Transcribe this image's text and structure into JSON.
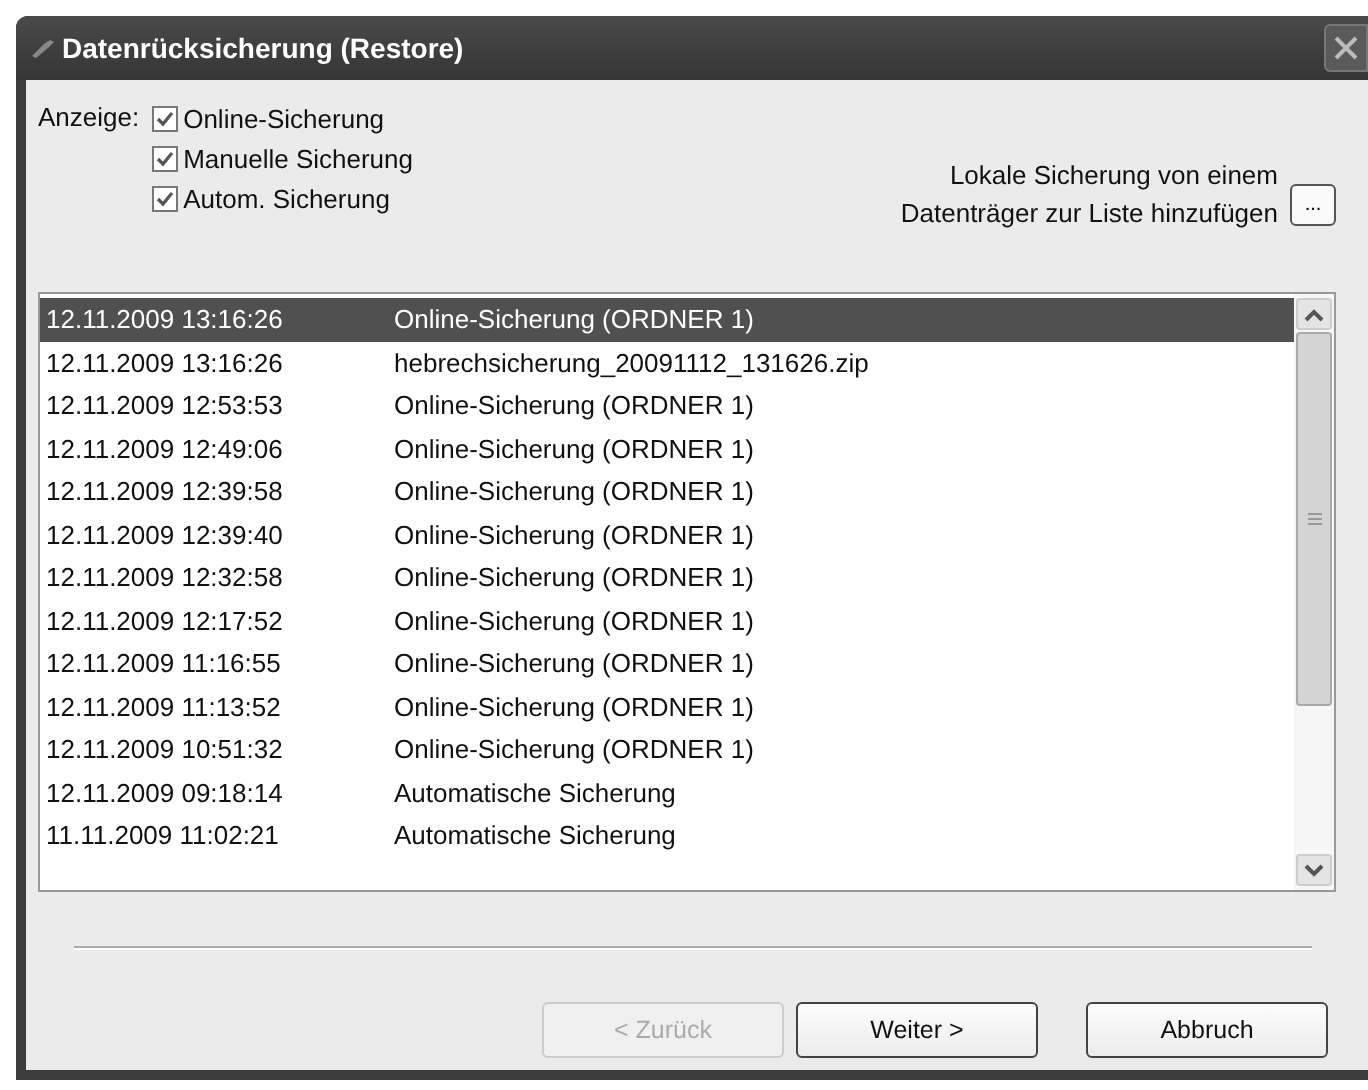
{
  "window": {
    "title": "Datenrücksicherung (Restore)"
  },
  "filter": {
    "label": "Anzeige:",
    "options": [
      {
        "label": "Online-Sicherung",
        "checked": true
      },
      {
        "label": "Manuelle Sicherung",
        "checked": true
      },
      {
        "label": "Autom. Sicherung",
        "checked": true
      }
    ]
  },
  "add_local": {
    "label_lines": [
      "Lokale Sicherung von einem",
      "Datenträger zur Liste hinzufügen"
    ],
    "button": "..."
  },
  "backups": [
    {
      "date": "12.11.2009 13:16:26",
      "name": "Online-Sicherung (ORDNER 1)",
      "selected": true
    },
    {
      "date": "12.11.2009 13:16:26",
      "name": "hebrechsicherung_20091112_131626.zip",
      "selected": false
    },
    {
      "date": "12.11.2009 12:53:53",
      "name": "Online-Sicherung (ORDNER 1)",
      "selected": false
    },
    {
      "date": "12.11.2009 12:49:06",
      "name": "Online-Sicherung (ORDNER 1)",
      "selected": false
    },
    {
      "date": "12.11.2009 12:39:58",
      "name": "Online-Sicherung (ORDNER 1)",
      "selected": false
    },
    {
      "date": "12.11.2009 12:39:40",
      "name": "Online-Sicherung (ORDNER 1)",
      "selected": false
    },
    {
      "date": "12.11.2009 12:32:58",
      "name": "Online-Sicherung (ORDNER 1)",
      "selected": false
    },
    {
      "date": "12.11.2009 12:17:52",
      "name": "Online-Sicherung (ORDNER 1)",
      "selected": false
    },
    {
      "date": "12.11.2009 11:16:55",
      "name": "Online-Sicherung (ORDNER 1)",
      "selected": false
    },
    {
      "date": "12.11.2009 11:13:52",
      "name": "Online-Sicherung (ORDNER 1)",
      "selected": false
    },
    {
      "date": "12.11.2009 10:51:32",
      "name": "Online-Sicherung (ORDNER 1)",
      "selected": false
    },
    {
      "date": "12.11.2009 09:18:14",
      "name": "Automatische Sicherung",
      "selected": false
    },
    {
      "date": "11.11.2009 11:02:21",
      "name": "Automatische Sicherung",
      "selected": false
    }
  ],
  "buttons": [
    {
      "label": "< Zurück",
      "disabled": true
    },
    {
      "label": "Weiter >",
      "disabled": false
    },
    {
      "label": "Abbruch",
      "disabled": false
    }
  ]
}
